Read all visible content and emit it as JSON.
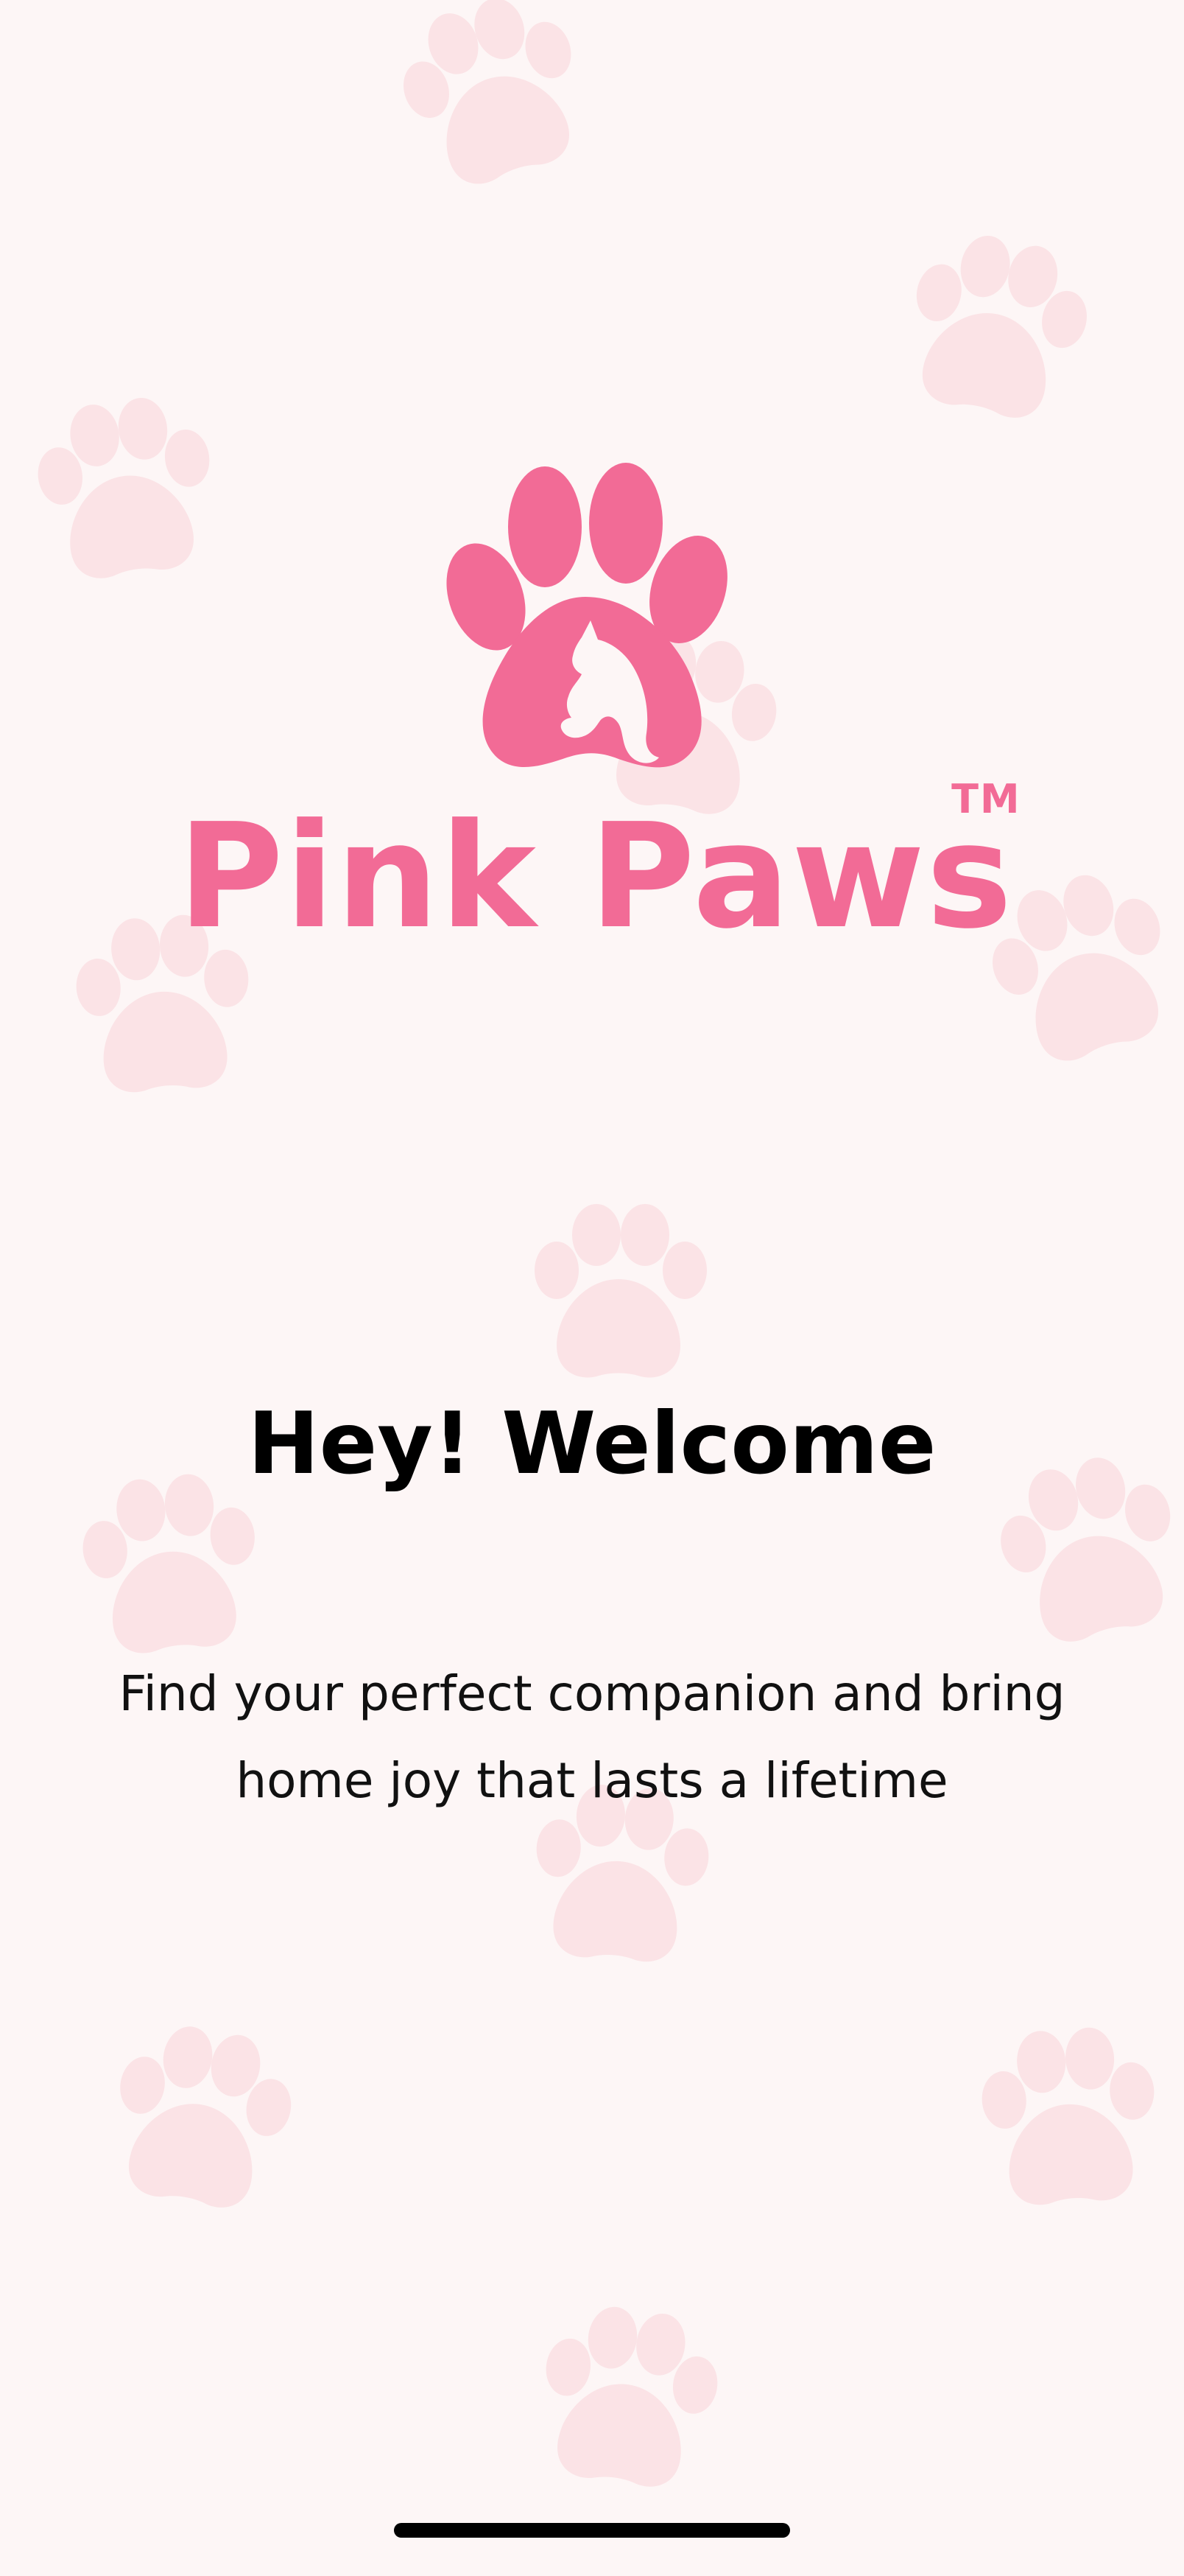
{
  "colors": {
    "background": "#FDF6F6",
    "brand_pink": "#F26B96",
    "paw_pattern": "#FBE3E6",
    "text": "#000000"
  },
  "logo": {
    "icon": "paw-with-cat-silhouette-icon",
    "brand_name": "Pink Paws",
    "trademark": "TM"
  },
  "welcome": {
    "title": "Hey! Welcome",
    "subtitle": "Find your perfect companion and bring home joy that lasts a lifetime"
  },
  "background_pattern": {
    "icon": "paw-print-icon"
  }
}
